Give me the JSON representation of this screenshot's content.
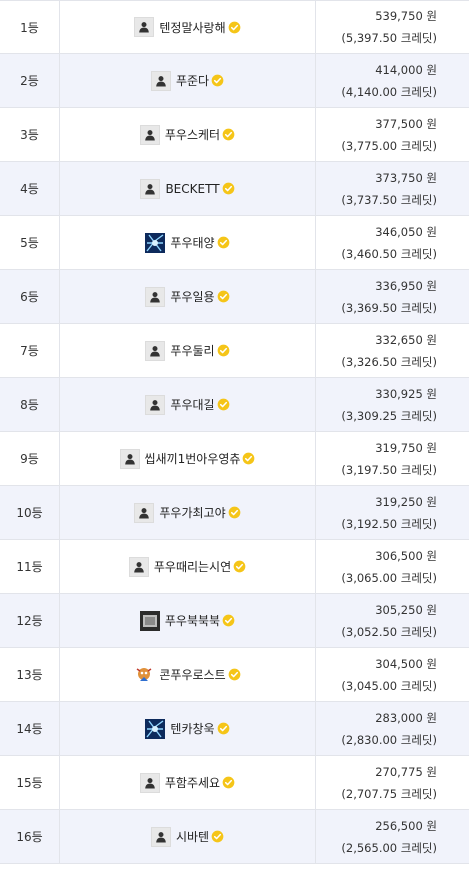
{
  "leaderboard": {
    "rows": [
      {
        "rank": "1등",
        "name": "텐정말사랑해",
        "avatar": "default-avatar",
        "amount": "539,750 원",
        "credits": "(5,397.50 크레딧)"
      },
      {
        "rank": "2등",
        "name": "푸준다",
        "avatar": "default-avatar",
        "amount": "414,000 원",
        "credits": "(4,140.00 크레딧)"
      },
      {
        "rank": "3등",
        "name": "푸우스케터",
        "avatar": "default-avatar",
        "amount": "377,500 원",
        "credits": "(3,775.00 크레딧)"
      },
      {
        "rank": "4등",
        "name": "BECKETT",
        "avatar": "default-avatar",
        "amount": "373,750 원",
        "credits": "(3,737.50 크레딧)"
      },
      {
        "rank": "5등",
        "name": "푸우태양",
        "avatar": "blue-image-avatar",
        "amount": "346,050 원",
        "credits": "(3,460.50 크레딧)"
      },
      {
        "rank": "6등",
        "name": "푸우일용",
        "avatar": "default-avatar",
        "amount": "336,950 원",
        "credits": "(3,369.50 크레딧)"
      },
      {
        "rank": "7등",
        "name": "푸우둘리",
        "avatar": "default-avatar",
        "amount": "332,650 원",
        "credits": "(3,326.50 크레딧)"
      },
      {
        "rank": "8등",
        "name": "푸우대길",
        "avatar": "default-avatar",
        "amount": "330,925 원",
        "credits": "(3,309.25 크레딧)"
      },
      {
        "rank": "9등",
        "name": "씹새끼1번아우영츄",
        "avatar": "default-avatar",
        "amount": "319,750 원",
        "credits": "(3,197.50 크레딧)"
      },
      {
        "rank": "10등",
        "name": "푸우가최고야",
        "avatar": "default-avatar",
        "amount": "319,250 원",
        "credits": "(3,192.50 크레딧)"
      },
      {
        "rank": "11등",
        "name": "푸우때리는시연",
        "avatar": "default-avatar",
        "amount": "306,500 원",
        "credits": "(3,065.00 크레딧)"
      },
      {
        "rank": "12등",
        "name": "푸우북북북",
        "avatar": "gray-image-avatar",
        "amount": "305,250 원",
        "credits": "(3,052.50 크레딧)"
      },
      {
        "rank": "13등",
        "name": "콘푸우로스트",
        "avatar": "character-avatar",
        "amount": "304,500 원",
        "credits": "(3,045.00 크레딧)"
      },
      {
        "rank": "14등",
        "name": "텐카창욱",
        "avatar": "blue-image-avatar",
        "amount": "283,000 원",
        "credits": "(2,830.00 크레딧)"
      },
      {
        "rank": "15등",
        "name": "푸함주세요",
        "avatar": "default-avatar",
        "amount": "270,775 원",
        "credits": "(2,707.75 크레딧)"
      },
      {
        "rank": "16등",
        "name": "시바텐",
        "avatar": "default-avatar",
        "amount": "256,500 원",
        "credits": "(2,565.00 크레딧)"
      }
    ]
  },
  "colors": {
    "row_alt": "#f1f3fb",
    "border": "#e2e4ea",
    "verified_badge": "#f5c518"
  }
}
